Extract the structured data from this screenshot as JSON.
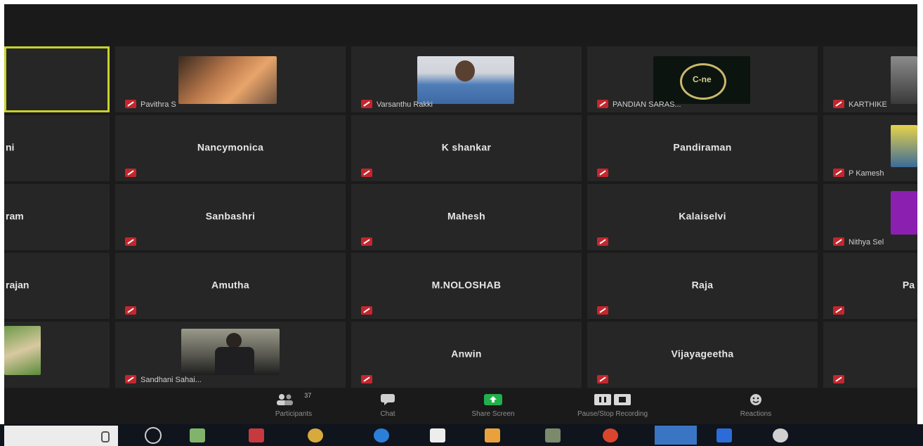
{
  "meeting": {
    "tiles_row1": [
      {
        "name": "",
        "has_video": false,
        "active": true
      },
      {
        "name": "Pavithra S",
        "has_video": true
      },
      {
        "name": "Varsanthu Rakki",
        "has_video": true
      },
      {
        "name": "PANDIAN SARAS...",
        "has_video": true
      },
      {
        "name": "KARTHIKE",
        "has_video": true
      }
    ],
    "tiles_row2": [
      {
        "name": "ni"
      },
      {
        "name": "Nancymonica"
      },
      {
        "name": "K shankar"
      },
      {
        "name": "Pandiraman"
      },
      {
        "name": "P Kamesh"
      }
    ],
    "tiles_row3": [
      {
        "name": "ram"
      },
      {
        "name": "Sanbashri"
      },
      {
        "name": "Mahesh"
      },
      {
        "name": "Kalaiselvi"
      },
      {
        "name": "Nithya Sel"
      }
    ],
    "tiles_row4": [
      {
        "name": "rajan"
      },
      {
        "name": "Amutha"
      },
      {
        "name": "M.NOLOSHAB"
      },
      {
        "name": "Raja"
      },
      {
        "name": "Pa"
      }
    ],
    "tiles_row5": [
      {
        "name": ""
      },
      {
        "name": "Sandhani Sahai..."
      },
      {
        "name": "Anwin"
      },
      {
        "name": "Vijayageetha"
      },
      {
        "name": ""
      }
    ]
  },
  "toolbar": {
    "participants_label": "Participants",
    "participants_count": "37",
    "chat_label": "Chat",
    "share_label": "Share Screen",
    "record_label": "Pause/Stop Recording",
    "reactions_label": "Reactions"
  },
  "icons": {
    "muted": "muted-mic-icon",
    "participants": "participants-icon",
    "chat": "chat-icon",
    "share": "share-screen-icon",
    "record": "pause-stop-recording-icon",
    "reactions": "reactions-icon"
  },
  "colors": {
    "active_border": "#c9d12a",
    "mute_red": "#c4262e",
    "share_green": "#21b04b"
  }
}
